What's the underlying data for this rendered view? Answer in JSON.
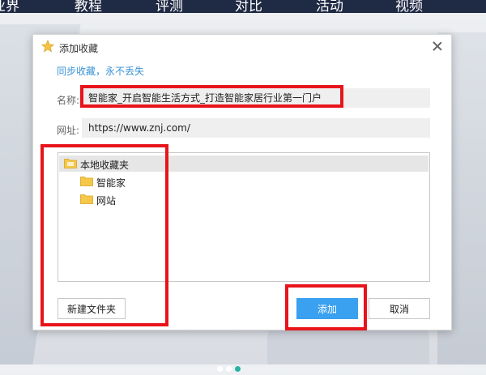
{
  "background_nav": {
    "items": [
      "业界",
      "教程",
      "评测",
      "对比",
      "活动",
      "视频"
    ]
  },
  "dialog": {
    "title": "添加收藏",
    "subtitle": "同步收藏，永不丢失",
    "name_label": "名称:",
    "name_value": "智能家_开启智能生活方式_打造智能家居行业第一门户",
    "url_label": "网址:",
    "url_value": "https://www.znj.com/",
    "folder_tree": {
      "root": "本地收藏夹",
      "children": [
        "智能家",
        "网站"
      ]
    },
    "new_folder_button": "新建文件夹",
    "add_button": "添加",
    "cancel_button": "取消"
  },
  "colors": {
    "accent": "#3aa0f0",
    "subtitle": "#3b93d6",
    "highlight": "#e8141b",
    "folder": "#f5c84a"
  }
}
